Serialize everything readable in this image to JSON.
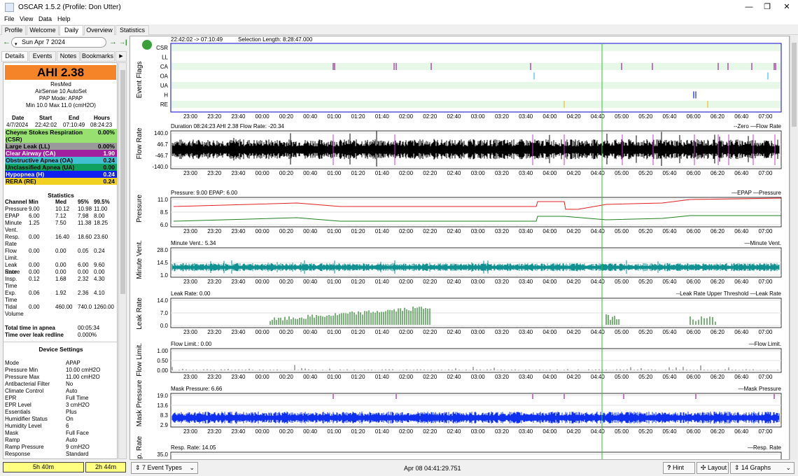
{
  "window": {
    "title": "OSCAR 1.5.2 (Profile: Don Utter)",
    "min": "—",
    "max": "❐",
    "close": "✕"
  },
  "menu": [
    "File",
    "View",
    "Data",
    "Help"
  ],
  "tabs": [
    "Profile",
    "Welcome",
    "Daily",
    "Overview",
    "Statistics"
  ],
  "active_tab": "Daily",
  "nav": {
    "back": "←",
    "date": "Sun Apr 7 2024",
    "forward": "→",
    "last": "→|"
  },
  "side_tabs": [
    "Details",
    "Events",
    "Notes",
    "Bookmarks"
  ],
  "summary": {
    "ahi": "AHI 2.38",
    "machine": "ResMed",
    "model": "AirSense 10 AutoSet",
    "mode": "PAP Mode: APAP",
    "pressure": "Min 10.0 Max 11.0 (cmH2O)"
  },
  "session": {
    "headers": [
      "Date",
      "Start",
      "End",
      "Hours"
    ],
    "values": [
      "4/7/2024",
      "22:42:02",
      "07:10:49",
      "08:24:23"
    ]
  },
  "events": [
    {
      "label": "Cheyne Stokes Respiration (CSR)",
      "value": "0.00%",
      "color": "#98e070"
    },
    {
      "label": "Large Leak (LL)",
      "value": "0.00%",
      "color": "#9a9a9a"
    },
    {
      "label": "Clear Airway (CA)",
      "value": "1.90",
      "color": "#a020a0"
    },
    {
      "label": "Obstructive Apnea (OA)",
      "value": "0.24",
      "color": "#40c0d0"
    },
    {
      "label": "Unclassified Apnea (UA)",
      "value": "0.00",
      "color": "#10a060"
    },
    {
      "label": "Hypopnea (H)",
      "value": "0.24",
      "color": "#1020f0"
    },
    {
      "label": "RERA (RE)",
      "value": "0.24",
      "color": "#f0d020"
    }
  ],
  "statistics": {
    "title": "Statistics",
    "headers": [
      "Channel",
      "Min",
      "Med",
      "95%",
      "99.5%"
    ],
    "rows": [
      [
        "Pressure",
        "9.00",
        "10.12",
        "10.98",
        "11.00"
      ],
      [
        "EPAP",
        "6.00",
        "7.12",
        "7.98",
        "8.00"
      ],
      [
        "Minute Vent.",
        "1.25",
        "7.50",
        "11.38",
        "18.25"
      ],
      [
        "Resp. Rate",
        "0.00",
        "16.40",
        "18.60",
        "23.60"
      ],
      [
        "Flow Limit.",
        "0.00",
        "0.00",
        "0.05",
        "0.24"
      ],
      [
        "Leak Rate",
        "0.00",
        "0.00",
        "6.00",
        "9.60"
      ],
      [
        "Snore",
        "0.00",
        "0.00",
        "0.00",
        "0.00"
      ],
      [
        "Insp. Time",
        "0.12",
        "1.68",
        "2.32",
        "4.30"
      ],
      [
        "Exp. Time",
        "0.06",
        "1.92",
        "2.36",
        "4.10"
      ],
      [
        "Tidal Volume",
        "0.00",
        "460.00",
        "740.0",
        "1260.00"
      ]
    ],
    "apnea_label": "Total time in apnea",
    "apnea_value": "00:05:34",
    "redline_label": "Time over leak redline",
    "redline_value": "0.000%"
  },
  "device": {
    "title": "Device Settings",
    "rows": [
      [
        "Mode",
        "APAP"
      ],
      [
        "Pressure Min",
        "10.00 cmH2O"
      ],
      [
        "Pressure Max",
        "11.00 cmH2O"
      ],
      [
        "Antibacterial Filter",
        "No"
      ],
      [
        "Climate Control",
        "Auto"
      ],
      [
        "EPR",
        "Full Time"
      ],
      [
        "EPR Level",
        "3 cmH2O"
      ],
      [
        "Essentials",
        "Plus"
      ],
      [
        "Humidifier Status",
        "On"
      ],
      [
        "Humidity Level",
        "6"
      ],
      [
        "Mask",
        "Full Face"
      ],
      [
        "Ramp",
        "Auto"
      ],
      [
        "Ramp Pressure",
        "9 cmH2O"
      ],
      [
        "Response",
        "Standard"
      ]
    ]
  },
  "bottom": {
    "b1": "5h 40m",
    "b2": "2h 44m",
    "event_types": "7 Event Types",
    "time": "Apr 08 04:41:29.751",
    "hint": "Hint",
    "layout": "Layout",
    "graphs": "14 Graphs"
  },
  "time_labels": [
    "23:00",
    "23:20",
    "23:40",
    "00:00",
    "00:20",
    "00:40",
    "01:00",
    "01:20",
    "01:40",
    "02:00",
    "02:20",
    "02:40",
    "03:00",
    "03:20",
    "03:40",
    "04:00",
    "04:20",
    "04:40",
    "05:00",
    "05:20",
    "05:40",
    "06:00",
    "06:20",
    "06:40",
    "07:00"
  ],
  "graphs": [
    {
      "id": "flags",
      "label": "Event Flags",
      "header": "22:42:02 -> 07:10:49",
      "header2": "Selection Length: 8:28:47.000",
      "rows": [
        "CSR",
        "LL",
        "CA",
        "OA",
        "UA",
        "H",
        "RE"
      ]
    },
    {
      "id": "flow",
      "label": "Flow Rate",
      "header": "Duration 08:24:23 AHI 2.38 Flow Rate: -20.34",
      "legend": "--Zero —Flow Rate",
      "yticks": [
        "140.0",
        "46.7",
        "-46.7",
        "-140.0"
      ]
    },
    {
      "id": "pressure",
      "label": "Pressure",
      "header": "Pressure: 9.00 EPAP: 6.00",
      "legend": "—EPAP —Pressure",
      "yticks": [
        "11.0",
        "8.5",
        "6.0"
      ]
    },
    {
      "id": "minvent",
      "label": "Minute Vent.",
      "header": "Minute Vent.: 5.34",
      "legend": "—Minute Vent.",
      "yticks": [
        "28.0",
        "14.5",
        "1.0"
      ]
    },
    {
      "id": "leak",
      "label": "Leak Rate",
      "header": "Leak Rate: 0.00",
      "legend": "--Leak Rate Upper Threshold —Leak Rate",
      "yticks": [
        "14.0",
        "7.0",
        "0.0"
      ]
    },
    {
      "id": "flowlimit",
      "label": "Flow Limit.",
      "header": "Flow Limit.: 0.00",
      "legend": "—Flow Limit.",
      "yticks": [
        "1.00",
        "0.50",
        "0.00"
      ]
    },
    {
      "id": "mask",
      "label": "Mask Pressure",
      "header": "Mask Pressure: 6.66",
      "legend": "—Mask Pressure",
      "yticks": [
        "19.0",
        "13.6",
        "8.3",
        "2.9"
      ]
    },
    {
      "id": "resp",
      "label": "Resp. Rate",
      "header": "Resp. Rate: 14.05",
      "legend": "—Resp. Rate",
      "yticks": [
        "35.0"
      ]
    }
  ]
}
